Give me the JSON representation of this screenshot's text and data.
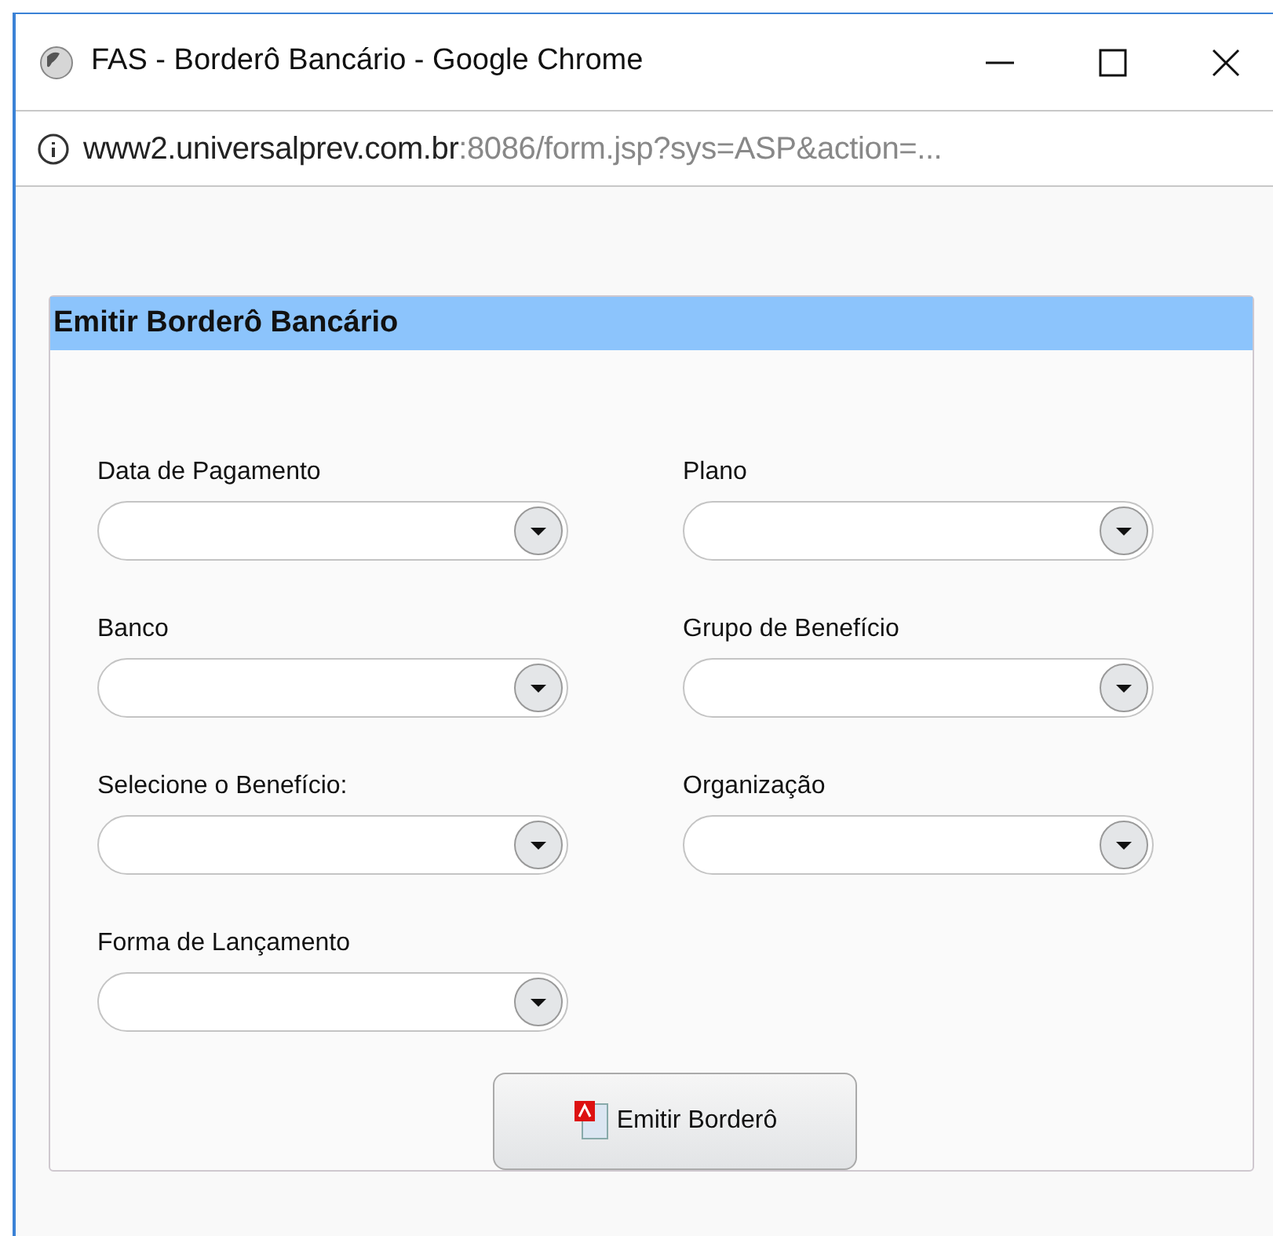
{
  "window": {
    "title": "FAS - Borderô Bancário - Google Chrome"
  },
  "address_bar": {
    "host": "www2.universalprev.com.br",
    "rest": ":8086/form.jsp?sys=ASP&action=..."
  },
  "panel": {
    "title": "Emitir Borderô Bancário"
  },
  "fields": [
    {
      "label": "Data de Pagamento"
    },
    {
      "label": "Plano"
    },
    {
      "label": "Banco"
    },
    {
      "label": "Grupo de Benefício"
    },
    {
      "label": "Selecione o Benefício:"
    },
    {
      "label": "Organização"
    },
    {
      "label": "Forma de Lançamento"
    }
  ],
  "button": {
    "label": "Emitir Borderô"
  }
}
